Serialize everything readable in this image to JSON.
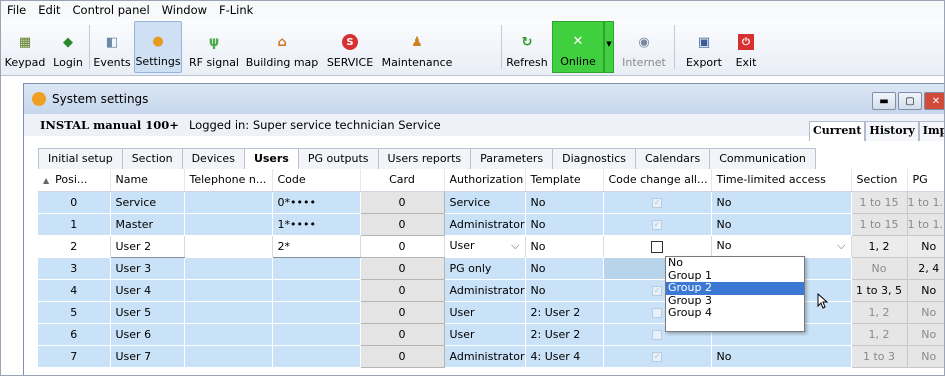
{
  "menu": [
    "File",
    "Edit",
    "Control panel",
    "Window",
    "F-Link"
  ],
  "toolbar": {
    "keypad": "Keypad",
    "login": "Login",
    "events": "Events",
    "settings": "Settings",
    "rf_signal": "RF signal",
    "building_map": "Building map",
    "service": "SERVICE",
    "maintenance": "Maintenance",
    "refresh": "Refresh",
    "online": "Online",
    "internet": "Internet",
    "export": "Export",
    "exit": "Exit"
  },
  "window": {
    "title": "System settings"
  },
  "info": {
    "device": "INSTAL manual 100+",
    "logged_in": "Logged in: Super service technician Service"
  },
  "right_tabs": [
    "Current",
    "History",
    "Impor"
  ],
  "tabs": [
    "Initial setup",
    "Section",
    "Devices",
    "Users",
    "PG outputs",
    "Users reports",
    "Parameters",
    "Diagnostics",
    "Calendars",
    "Communication"
  ],
  "active_tab": "Users",
  "columns": [
    "Posi...",
    "Name",
    "Telephone n...",
    "Code",
    "Card",
    "Authorization",
    "Template",
    "Code change all...",
    "Time-limited access",
    "Section",
    "PG"
  ],
  "rows": [
    {
      "pos": "0",
      "name": "Service",
      "tel": "",
      "code": "0*••••",
      "card": "0",
      "auth": "Service",
      "template": "No",
      "access": "No",
      "section": "1 to 15",
      "pg": "1 to 1..."
    },
    {
      "pos": "1",
      "name": "Master",
      "tel": "",
      "code": "1*••••",
      "card": "0",
      "auth": "Administrator",
      "template": "No",
      "access": "No",
      "section": "1 to 15",
      "pg": "1 to 1..."
    },
    {
      "pos": "2",
      "name": "User 2",
      "tel": "",
      "code": "2*",
      "card": "0",
      "auth": "User",
      "template": "No",
      "access": "No",
      "section": "1, 2",
      "pg": "No"
    },
    {
      "pos": "3",
      "name": "User 3",
      "tel": "",
      "code": "",
      "card": "0",
      "auth": "PG only",
      "template": "No",
      "access": "",
      "section": "No",
      "pg": "2, 4"
    },
    {
      "pos": "4",
      "name": "User 4",
      "tel": "",
      "code": "",
      "card": "0",
      "auth": "Administrator",
      "template": "No",
      "access": "",
      "section": "1 to 3, 5",
      "pg": "No"
    },
    {
      "pos": "5",
      "name": "User 5",
      "tel": "",
      "code": "",
      "card": "0",
      "auth": "User",
      "template": "2: User 2",
      "access": "",
      "section": "1, 2",
      "pg": "No"
    },
    {
      "pos": "6",
      "name": "User 6",
      "tel": "",
      "code": "",
      "card": "0",
      "auth": "User",
      "template": "2: User 2",
      "access": "",
      "section": "1, 2",
      "pg": "No"
    },
    {
      "pos": "7",
      "name": "User 7",
      "tel": "",
      "code": "",
      "card": "0",
      "auth": "Administrator",
      "template": "4: User 4",
      "access": "No",
      "section": "1 to 3",
      "pg": "No"
    }
  ],
  "dropdown": {
    "options": [
      "No",
      "Group 1",
      "Group 2",
      "Group 3",
      "Group 4"
    ],
    "highlighted": "Group 2"
  },
  "colors": {
    "accent": "#3a78d4",
    "row_bg": "#c9e2f7",
    "online": "#3fcf3f"
  }
}
